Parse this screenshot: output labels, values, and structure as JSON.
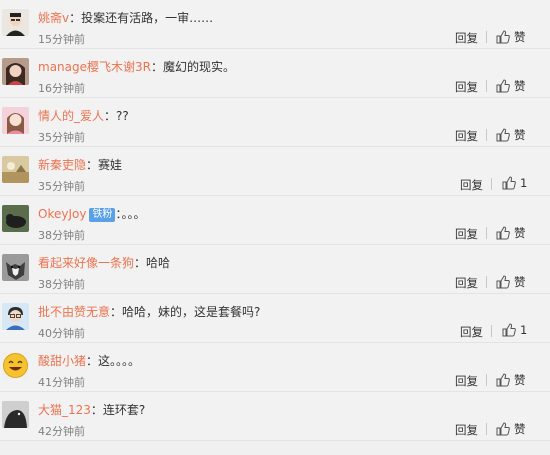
{
  "comments": [
    {
      "user": "姚斋v",
      "sep": "：",
      "text": "投案还有活路，一审……",
      "time": "15分钟前",
      "reply": "回复",
      "like": "赞",
      "avatar": "man-glasses",
      "color": "#d8d0c8"
    },
    {
      "user": "manage樱飞木谢3R",
      "sep": "：",
      "text": "魔幻的现实。",
      "time": "16分钟前",
      "reply": "回复",
      "like": "赞",
      "avatar": "girl-dark",
      "color": "#8a6d5c"
    },
    {
      "user": "情人的_爱人",
      "sep": "：",
      "text": "??",
      "time": "35分钟前",
      "reply": "回复",
      "like": "赞",
      "avatar": "girl-pink",
      "color": "#e7b8c3"
    },
    {
      "user": "新秦吏隐",
      "sep": "：",
      "text": "赛娃",
      "time": "35分钟前",
      "reply": "回复",
      "like": "1",
      "avatar": "landscape",
      "color": "#c9b58a"
    },
    {
      "user": "OkeyJoy",
      "badge": "铁粉",
      "sep": "：",
      "text": "。。。",
      "time": "38分钟前",
      "reply": "回复",
      "like": "赞",
      "avatar": "dog-dark",
      "color": "#3e4a36"
    },
    {
      "user": "看起来好像一条狗",
      "sep": "：",
      "text": "哈哈",
      "time": "38分钟前",
      "reply": "回复",
      "like": "赞",
      "avatar": "husky",
      "color": "#7c7c7c"
    },
    {
      "user": "批不由赞无意",
      "sep": "：",
      "text": "哈哈，妹的，这是套餐吗?",
      "time": "40分钟前",
      "reply": "回复",
      "like": "1",
      "avatar": "cartoon-man",
      "color": "#bcd6ec"
    },
    {
      "user": "酸甜小猪",
      "sep": "：",
      "text": "这。。。。",
      "time": "41分钟前",
      "reply": "回复",
      "like": "赞",
      "avatar": "smiley",
      "color": "#f5c330"
    },
    {
      "user": "大猫_123",
      "sep": "：",
      "text": "连环套?",
      "time": "42分钟前",
      "reply": "回复",
      "like": "赞",
      "avatar": "dark-bird",
      "color": "#3a3a3a"
    }
  ]
}
